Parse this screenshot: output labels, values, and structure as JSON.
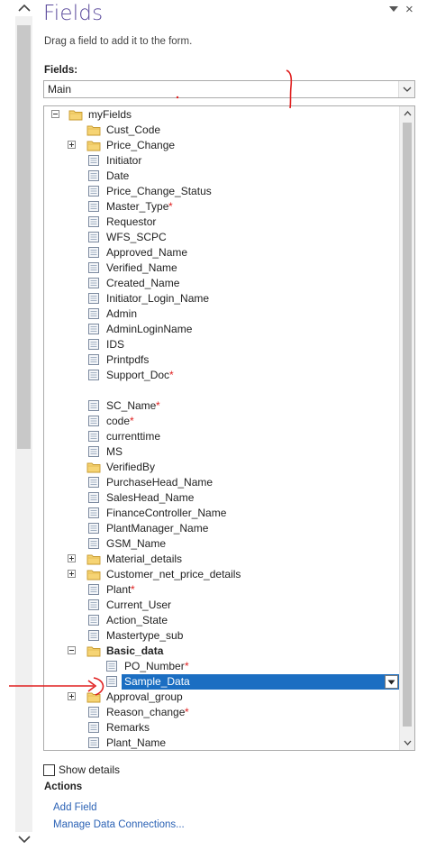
{
  "pane": {
    "title": "Fields",
    "subtitle": "Drag a field to add it to the form.",
    "fields_label": "Fields:",
    "group_value": "Main",
    "close_glyph": "×"
  },
  "tree": [
    {
      "id": "myFields",
      "label": "myFields",
      "level": 0,
      "type": "folder",
      "expander": "minus",
      "required": false
    },
    {
      "id": "Cust_Code",
      "label": "Cust_Code",
      "level": 1,
      "type": "folder",
      "expander": "none",
      "required": false
    },
    {
      "id": "Price_Change",
      "label": "Price_Change",
      "level": 1,
      "type": "folder",
      "expander": "plus",
      "required": false
    },
    {
      "id": "Initiator",
      "label": "Initiator",
      "level": 1,
      "type": "field",
      "expander": "none",
      "required": false
    },
    {
      "id": "Date",
      "label": "Date",
      "level": 1,
      "type": "field",
      "expander": "none",
      "required": false
    },
    {
      "id": "Price_Change_Status",
      "label": "Price_Change_Status",
      "level": 1,
      "type": "field",
      "expander": "none",
      "required": false
    },
    {
      "id": "Master_Type",
      "label": "Master_Type",
      "level": 1,
      "type": "field",
      "expander": "none",
      "required": true
    },
    {
      "id": "Requestor",
      "label": "Requestor",
      "level": 1,
      "type": "field",
      "expander": "none",
      "required": false
    },
    {
      "id": "WFS_SCPC",
      "label": "WFS_SCPC",
      "level": 1,
      "type": "field",
      "expander": "none",
      "required": false
    },
    {
      "id": "Approved_Name",
      "label": "Approved_Name",
      "level": 1,
      "type": "field",
      "expander": "none",
      "required": false
    },
    {
      "id": "Verified_Name",
      "label": "Verified_Name",
      "level": 1,
      "type": "field",
      "expander": "none",
      "required": false
    },
    {
      "id": "Created_Name",
      "label": "Created_Name",
      "level": 1,
      "type": "field",
      "expander": "none",
      "required": false
    },
    {
      "id": "Initiator_Login_Name",
      "label": "Initiator_Login_Name",
      "level": 1,
      "type": "field",
      "expander": "none",
      "required": false
    },
    {
      "id": "Admin",
      "label": "Admin",
      "level": 1,
      "type": "field",
      "expander": "none",
      "required": false
    },
    {
      "id": "AdminLoginName",
      "label": "AdminLoginName",
      "level": 1,
      "type": "field",
      "expander": "none",
      "required": false
    },
    {
      "id": "IDS",
      "label": "IDS",
      "level": 1,
      "type": "field",
      "expander": "none",
      "required": false
    },
    {
      "id": "Printpdfs",
      "label": "Printpdfs",
      "level": 1,
      "type": "field",
      "expander": "none",
      "required": false
    },
    {
      "id": "Support_Doc",
      "label": "Support_Doc",
      "level": 1,
      "type": "field",
      "expander": "none",
      "required": true
    },
    {
      "id": "blank",
      "label": "",
      "level": 1,
      "type": "blank",
      "expander": "none",
      "required": false
    },
    {
      "id": "SC_Name",
      "label": "SC_Name",
      "level": 1,
      "type": "field",
      "expander": "none",
      "required": true
    },
    {
      "id": "code",
      "label": "code",
      "level": 1,
      "type": "field",
      "expander": "none",
      "required": true
    },
    {
      "id": "currenttime",
      "label": "currenttime",
      "level": 1,
      "type": "field",
      "expander": "none",
      "required": false
    },
    {
      "id": "MS",
      "label": "MS",
      "level": 1,
      "type": "field",
      "expander": "none",
      "required": false
    },
    {
      "id": "VerifiedBy",
      "label": "VerifiedBy",
      "level": 1,
      "type": "folder",
      "expander": "none",
      "required": false
    },
    {
      "id": "PurchaseHead_Name",
      "label": "PurchaseHead_Name",
      "level": 1,
      "type": "field",
      "expander": "none",
      "required": false
    },
    {
      "id": "SalesHead_Name",
      "label": "SalesHead_Name",
      "level": 1,
      "type": "field",
      "expander": "none",
      "required": false
    },
    {
      "id": "FinanceController_Name",
      "label": "FinanceController_Name",
      "level": 1,
      "type": "field",
      "expander": "none",
      "required": false
    },
    {
      "id": "PlantManager_Name",
      "label": "PlantManager_Name",
      "level": 1,
      "type": "field",
      "expander": "none",
      "required": false
    },
    {
      "id": "GSM_Name",
      "label": "GSM_Name",
      "level": 1,
      "type": "field",
      "expander": "none",
      "required": false
    },
    {
      "id": "Material_details",
      "label": "Material_details",
      "level": 1,
      "type": "folder",
      "expander": "plus",
      "required": false
    },
    {
      "id": "Customer_net_price_details",
      "label": "Customer_net_price_details",
      "level": 1,
      "type": "folder",
      "expander": "plus",
      "required": false
    },
    {
      "id": "Plant",
      "label": "Plant",
      "level": 1,
      "type": "field",
      "expander": "none",
      "required": true
    },
    {
      "id": "Current_User",
      "label": "Current_User",
      "level": 1,
      "type": "field",
      "expander": "none",
      "required": false
    },
    {
      "id": "Action_State",
      "label": "Action_State",
      "level": 1,
      "type": "field",
      "expander": "none",
      "required": false
    },
    {
      "id": "Mastertype_sub",
      "label": "Mastertype_sub",
      "level": 1,
      "type": "field",
      "expander": "none",
      "required": false
    },
    {
      "id": "Basic_data",
      "label": "Basic_data",
      "level": 1,
      "type": "folder",
      "expander": "minus",
      "required": false,
      "bold": true
    },
    {
      "id": "PO_Number",
      "label": "PO_Number",
      "level": 2,
      "type": "field",
      "expander": "none",
      "required": true
    },
    {
      "id": "Sample_Data",
      "label": "Sample_Data",
      "level": 2,
      "type": "field",
      "expander": "none",
      "required": false,
      "selected": true
    },
    {
      "id": "Approval_group",
      "label": "Approval_group",
      "level": 1,
      "type": "folder",
      "expander": "plus",
      "required": false
    },
    {
      "id": "Reason_change",
      "label": "Reason_change",
      "level": 1,
      "type": "field",
      "expander": "none",
      "required": true
    },
    {
      "id": "Remarks",
      "label": "Remarks",
      "level": 1,
      "type": "field",
      "expander": "none",
      "required": false
    },
    {
      "id": "Plant_Name",
      "label": "Plant_Name",
      "level": 1,
      "type": "field",
      "expander": "none",
      "required": false
    }
  ],
  "required_mark": "*",
  "footer": {
    "show_details_label": "Show details",
    "show_details_checked": false,
    "actions_label": "Actions",
    "add_field": "Add Field",
    "manage_connections": "Manage Data Connections..."
  },
  "colors": {
    "title": "#5b4a9c",
    "selection": "#1b6ec2",
    "link": "#2b62b5",
    "required": "#e02020",
    "annotation": "#e02020"
  },
  "icons": {
    "folder": "folder-icon",
    "field": "field-icon",
    "expand": "plus-box-icon",
    "collapse": "minus-box-icon"
  }
}
